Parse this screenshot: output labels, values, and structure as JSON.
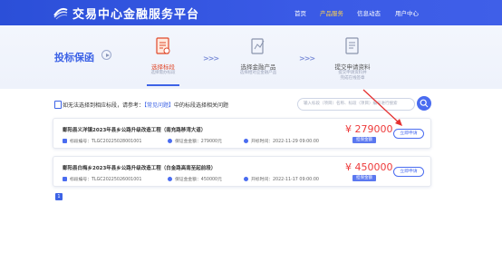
{
  "header": {
    "brand": "交易中心金融服务平台",
    "nav": [
      {
        "label": "首页",
        "active": false
      },
      {
        "label": "产品服务",
        "active": true
      },
      {
        "label": "信息动态",
        "active": false
      },
      {
        "label": "用户中心",
        "active": false
      }
    ]
  },
  "steps": {
    "title": "投标保函",
    "items": [
      {
        "title": "选择标段",
        "sub": "选择需办标段",
        "active": true
      },
      {
        "title": "选择金融产品",
        "sub": "选择相对应金融产品",
        "active": false
      },
      {
        "title": "提交申请资料",
        "sub": "提交申请资料并完成在线签章",
        "active": false
      }
    ],
    "arrows": ">>>"
  },
  "notice": {
    "prefix": "如无法选择到相应标段，请参考：",
    "link": "【常见问题】",
    "suffix": "中的标段选择相关问题"
  },
  "search": {
    "placeholder": "输入标段（项目）名称、标段（项目）编号进行搜索"
  },
  "list": [
    {
      "title": "鄱阳县义洋镇2023年县乡公路升级改造工程（南充路移湾大道）",
      "code_label": "标段编号：TLGC20225028001001",
      "amount_label": "保证金金额：279000元",
      "open_label": "开标时间：2022-11-29 09:00:00",
      "price": "¥ 279000",
      "badge": "担保金额",
      "apply": "立即申请"
    },
    {
      "title": "鄱阳县白梅乡2023年县乡公路升级改造工程（白金路高南至起前段）",
      "code_label": "标段编号：TLGC20225026001001",
      "amount_label": "保证金金额：450000元",
      "open_label": "开标时间：2022-11-17 09:00:00",
      "price": "¥ 450000",
      "badge": "担保金额",
      "apply": "立即申请"
    }
  ],
  "pagination": {
    "current": "1"
  },
  "colors": {
    "primary": "#3d63e6",
    "price": "#ee3b3b",
    "annotation": "#e53030"
  }
}
